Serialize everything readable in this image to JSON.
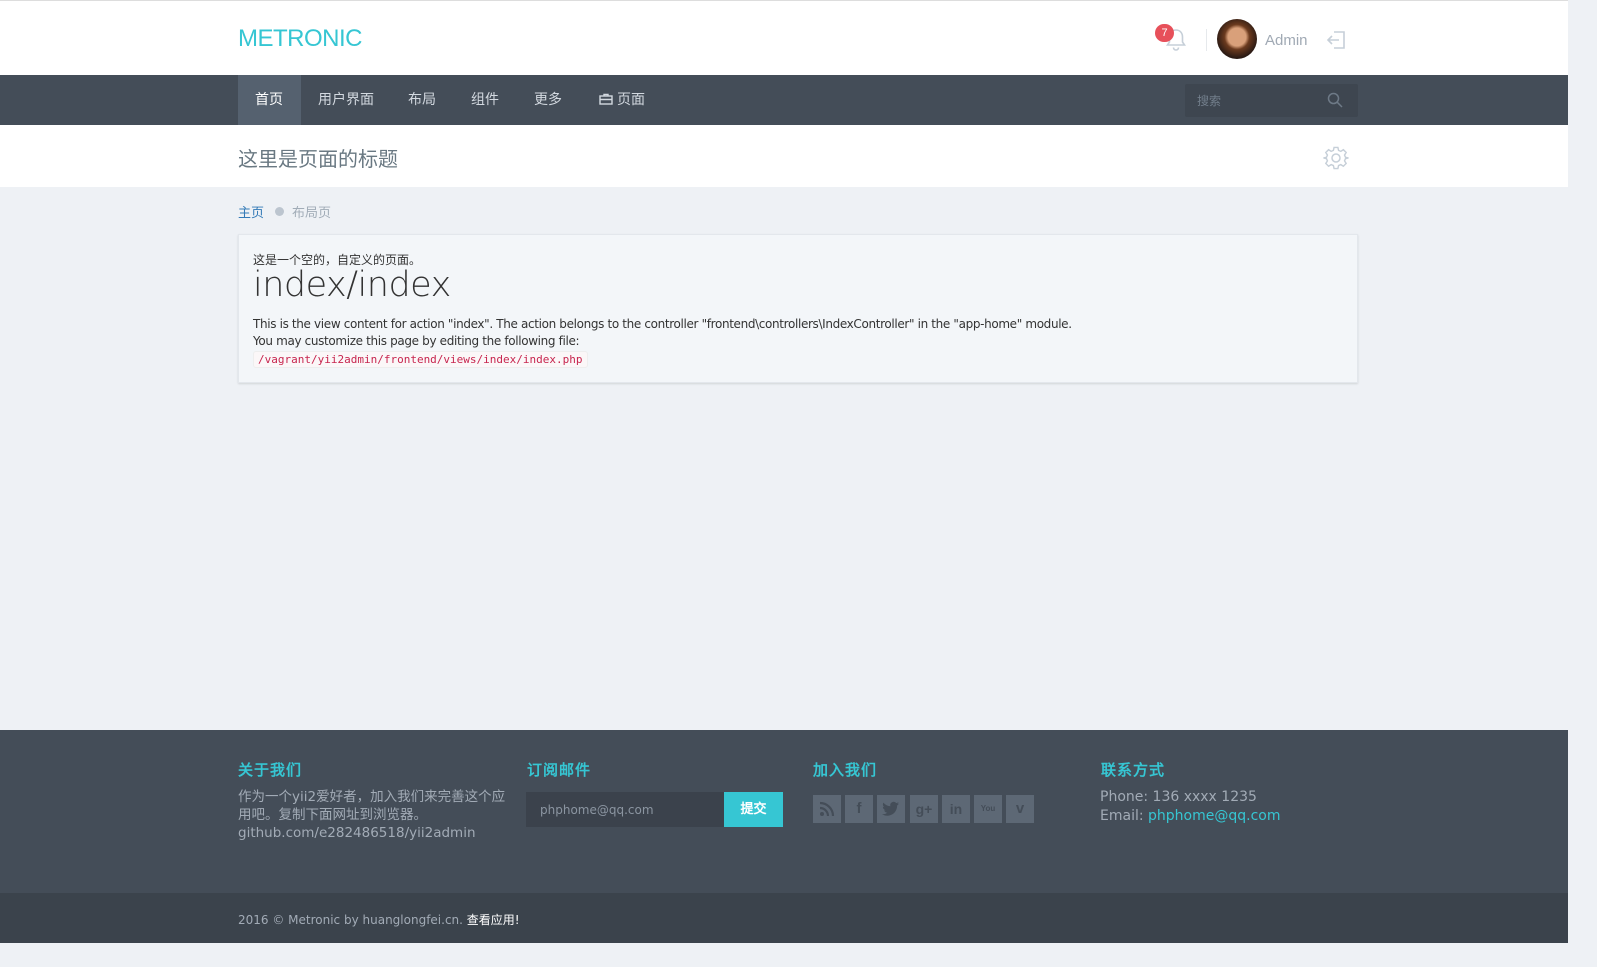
{
  "header": {
    "logo": "METRONIC",
    "notification_count": "7",
    "user_name": "Admin"
  },
  "nav": {
    "items": [
      {
        "label": "首页"
      },
      {
        "label": "用户界面"
      },
      {
        "label": "布局"
      },
      {
        "label": "组件"
      },
      {
        "label": "更多"
      },
      {
        "label": "页面"
      }
    ],
    "search_placeholder": "搜索"
  },
  "page": {
    "title": "这里是页面的标题"
  },
  "breadcrumb": {
    "home": "主页",
    "current": "布局页"
  },
  "panel": {
    "intro": "这是一个空的，自定义的页面。",
    "heading": "index/index",
    "line1": "This is the view content for action \"index\". The action belongs to the controller \"frontend\\controllers\\IndexController\" in the \"app-home\" module.",
    "line2": "You may customize this page by editing the following file:",
    "file_path": "/vagrant/yii2admin/frontend/views/index/index.php"
  },
  "footer": {
    "about_title": "关于我们",
    "about_text": "作为一个yii2爱好者，加入我们来完善这个应用吧。复制下面网址到浏览器。",
    "about_link": "github.com/e282486518/yii2admin",
    "subscribe_title": "订阅邮件",
    "email_placeholder": "phphome@qq.com",
    "submit_label": "提交",
    "join_title": "加入我们",
    "social": [
      "rss-icon",
      "facebook-icon",
      "twitter-icon",
      "googleplus-icon",
      "linkedin-icon",
      "youtube-icon",
      "vimeo-icon"
    ],
    "contact_title": "联系方式",
    "phone": "Phone: 136 xxxx 1235",
    "email_label": "Email: ",
    "email_value": "phphome@qq.com"
  },
  "copyright": {
    "text": "2016 © Metronic by huanglongfei.cn. ",
    "link": "查看应用!"
  },
  "colors": {
    "accent": "#36c6d3",
    "nav_bg": "#444d58",
    "body_bg": "#eef1f5",
    "badge": "#e7505a"
  }
}
